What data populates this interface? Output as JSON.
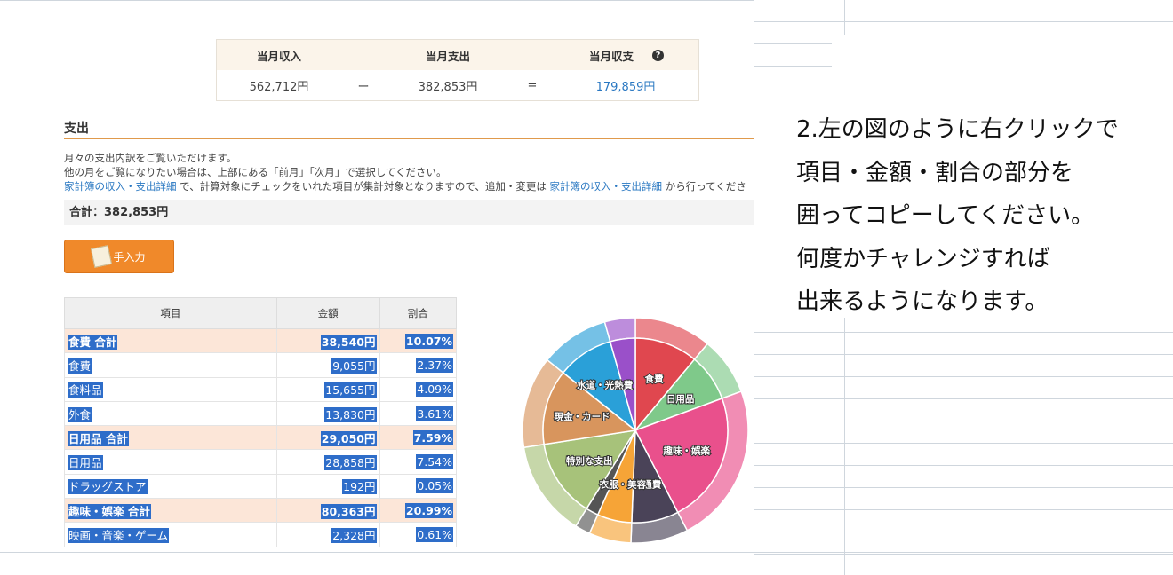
{
  "summary": {
    "income_label": "当月収入",
    "expense_label": "当月支出",
    "balance_label": "当月収支",
    "income_value": "562,712円",
    "minus_sign": "ー",
    "expense_value": "382,853円",
    "equals_sign": "=",
    "balance_value": "179,859円",
    "help_glyph": "?"
  },
  "section": {
    "title": "支出",
    "desc_line1": "月々の支出内訳をご覧いただけます。",
    "desc_line2": "他の月をご覧になりたい場合は、上部にある「前月」「次月」で選択してください。",
    "desc_link1": "家計簿の収入・支出詳細",
    "desc_mid": " で、計算対象にチェックをいれた項目が集計対象となりますので、追加・変更は ",
    "desc_link2": "家計簿の収入・支出詳細",
    "desc_tail": " から行ってくださ",
    "total": "合計：382,853円",
    "manual_button": "手入力"
  },
  "table": {
    "headers": [
      "項目",
      "金額",
      "割合"
    ],
    "rows": [
      {
        "item": "食費 合計",
        "amount": "38,540円",
        "ratio": "10.07%",
        "subtotal": true
      },
      {
        "item": "食費",
        "amount": "9,055円",
        "ratio": "2.37%",
        "subtotal": false
      },
      {
        "item": "食料品",
        "amount": "15,655円",
        "ratio": "4.09%",
        "subtotal": false
      },
      {
        "item": "外食",
        "amount": "13,830円",
        "ratio": "3.61%",
        "subtotal": false
      },
      {
        "item": "日用品 合計",
        "amount": "29,050円",
        "ratio": "7.59%",
        "subtotal": true
      },
      {
        "item": "日用品",
        "amount": "28,858円",
        "ratio": "7.54%",
        "subtotal": false
      },
      {
        "item": "ドラッグストア",
        "amount": "192円",
        "ratio": "0.05%",
        "subtotal": false
      },
      {
        "item": "趣味・娯楽 合計",
        "amount": "80,363円",
        "ratio": "20.99%",
        "subtotal": true
      },
      {
        "item": "映画・音楽・ゲーム",
        "amount": "2,328円",
        "ratio": "0.61%",
        "subtotal": false
      }
    ]
  },
  "chart_data": {
    "type": "pie",
    "series": [
      {
        "name": "食費",
        "value": 10.07,
        "color": "#e0474f"
      },
      {
        "name": "日用品",
        "value": 7.59,
        "color": "#7fc98a"
      },
      {
        "name": "趣味・娯楽",
        "value": 20.99,
        "color": "#e9508c"
      },
      {
        "name": "交通費",
        "value": 7.5,
        "color": "#4a4358"
      },
      {
        "name": "衣服・美容",
        "value": 5.5,
        "color": "#f6a437"
      },
      {
        "name": "",
        "value": 2.0,
        "color": "#555555"
      },
      {
        "name": "特別な支出",
        "value": 12.5,
        "color": "#a7c27a"
      },
      {
        "name": "現金・カード",
        "value": 12.0,
        "color": "#d8955d"
      },
      {
        "name": "水道・光熱費",
        "value": 9.0,
        "color": "#2aa0d8"
      },
      {
        "name": "",
        "value": 4.0,
        "color": "#9a50c9"
      }
    ]
  },
  "note": {
    "lines": [
      "2.左の図のように右クリックで",
      "項目・金額・割合の部分を",
      "囲ってコピーしてください。",
      "何度かチャレンジすれば",
      "出来るようになります。"
    ]
  }
}
